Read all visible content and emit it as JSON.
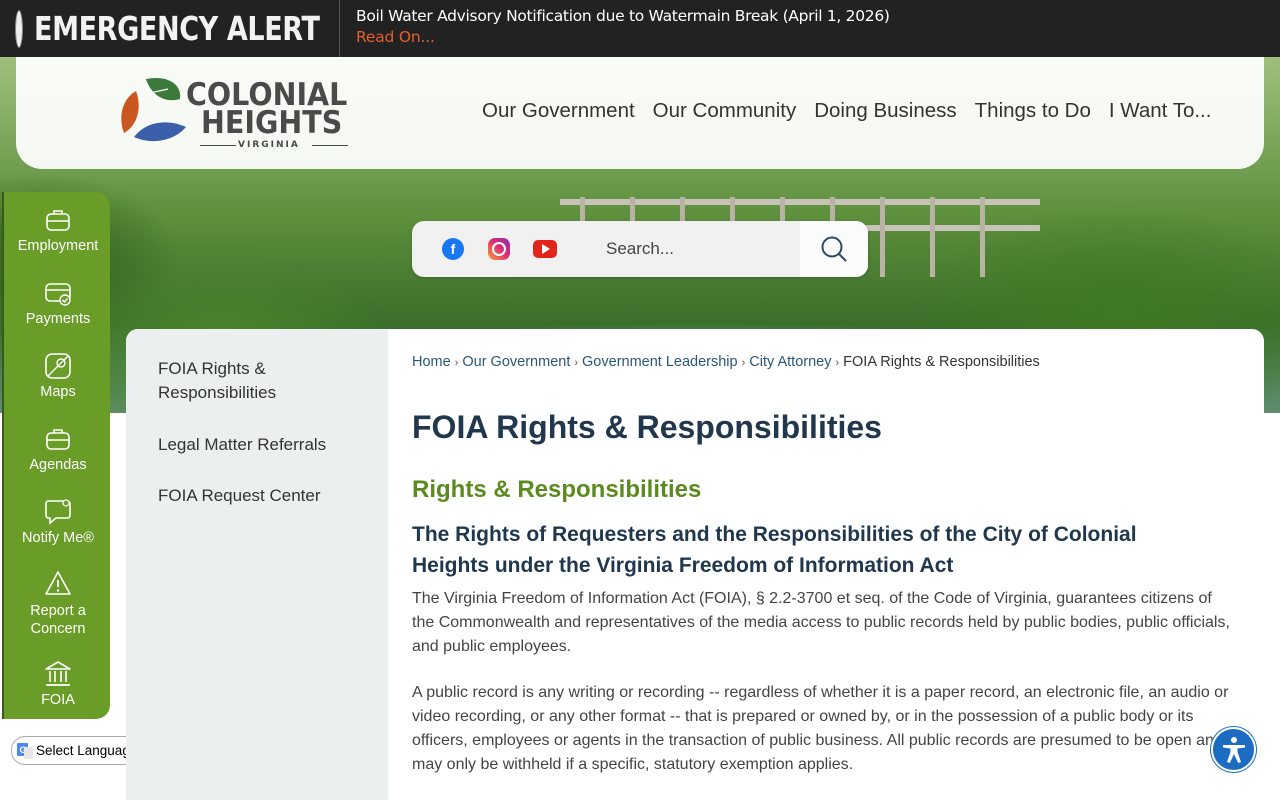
{
  "alert": {
    "title": "EMERGENCY ALERT",
    "message": "Boil Water Advisory Notification due to Watermain Break (April 1, 2026)",
    "link": "Read On..."
  },
  "logo": {
    "line1": "COLONIAL",
    "line2": "HEIGHTS",
    "line3": "VIRGINIA"
  },
  "nav": {
    "items": [
      "Our Government",
      "Our Community",
      "Doing Business",
      "Things to Do",
      "I Want To..."
    ]
  },
  "search": {
    "placeholder": "Search..."
  },
  "social": {
    "icons": [
      "facebook-icon",
      "instagram-icon",
      "youtube-icon"
    ]
  },
  "quicklinks": {
    "items": [
      {
        "label": "Employment",
        "icon": "briefcase-icon"
      },
      {
        "label": "Payments",
        "icon": "credit-card-icon"
      },
      {
        "label": "Maps",
        "icon": "map-icon"
      },
      {
        "label": "Agendas",
        "icon": "briefcase-icon"
      },
      {
        "label": "Notify Me®",
        "icon": "chat-bubble-icon"
      },
      {
        "label": "Report a Concern",
        "icon": "warning-icon"
      },
      {
        "label": "FOIA",
        "icon": "building-icon"
      }
    ]
  },
  "language": {
    "label": "Select Language"
  },
  "sidenav": {
    "items": [
      "FOIA Rights & Responsibilities",
      "Legal Matter Referrals",
      "FOIA Request Center"
    ]
  },
  "breadcrumb": {
    "items": [
      "Home",
      "Our Government",
      "Government Leadership",
      "City Attorney"
    ],
    "current": "FOIA Rights & Responsibilities"
  },
  "content": {
    "title": "FOIA Rights & Responsibilities",
    "subtitle": "Rights & Responsibilities",
    "heading": "The Rights of Requesters and the Responsibilities of the City of Colonial Heights under the Virginia Freedom of Information Act",
    "paragraphs": [
      "The Virginia Freedom of Information Act (FOIA), § 2.2-3700 et seq. of the Code of Virginia, guarantees citizens of the Commonwealth and representatives of the media access to public records held by public bodies, public officials, and public employees.",
      "A public record is any writing or recording -- regardless of whether it is a paper record, an electronic file, an audio or video recording, or any other format -- that is prepared or owned by, or in the possession of a public body or its officers, employees or agents in the transaction of public business.  All public records are presumed to be open and may only be withheld if a specific, statutory exemption applies."
    ]
  },
  "colors": {
    "alert_bg": "#222222",
    "alert_link": "#e35f2b",
    "rail_green": "#6a9c28",
    "title_navy": "#21374d",
    "subtitle_green": "#5c8a1f",
    "a11y_blue": "#1b6cc2"
  }
}
